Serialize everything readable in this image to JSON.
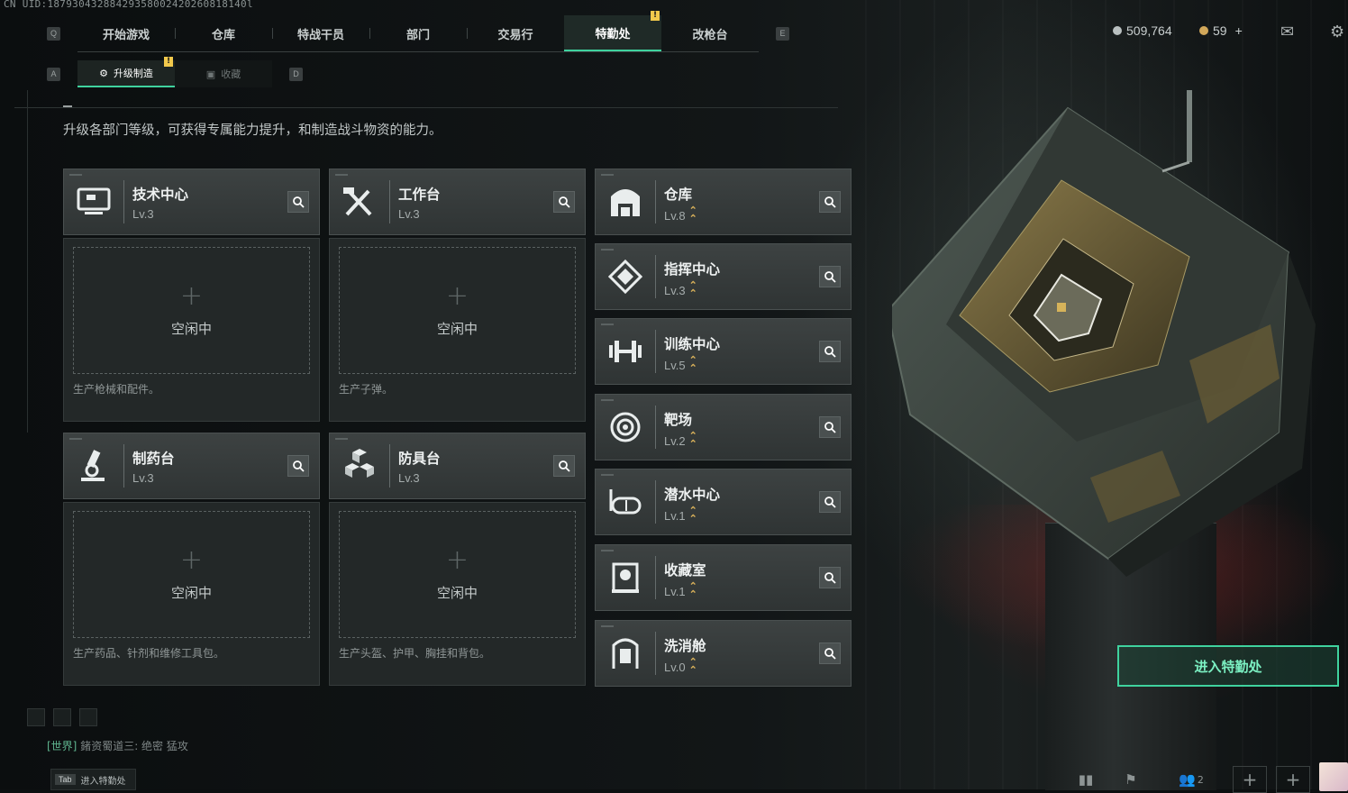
{
  "uid": "CN UID:18793043288429358002420260818140l",
  "nav": {
    "left_key": "Q",
    "right_key": "E",
    "tabs": [
      {
        "label": "开始游戏",
        "active": false
      },
      {
        "label": "仓库",
        "active": false
      },
      {
        "label": "特战干员",
        "active": false
      },
      {
        "label": "部门",
        "active": false
      },
      {
        "label": "交易行",
        "active": false
      },
      {
        "label": "特勤处",
        "active": true,
        "alert": "!"
      },
      {
        "label": "改枪台",
        "active": false
      }
    ]
  },
  "currency": {
    "coins": "509,764",
    "bonds": "59",
    "add": "+"
  },
  "subnav": {
    "left_key": "A",
    "right_key": "D",
    "tabs": [
      {
        "label": "升级制造",
        "active": true,
        "alert": "!"
      },
      {
        "label": "收藏",
        "active": false
      }
    ]
  },
  "description": "升级各部门等级，可获得专属能力提升，和制造战斗物资的能力。",
  "production_departments": [
    {
      "name": "技术中心",
      "level": "Lv.3",
      "icon": "monitor-icon",
      "status": "空闲中",
      "desc": "生产枪械和配件。"
    },
    {
      "name": "工作台",
      "level": "Lv.3",
      "icon": "tools-icon",
      "status": "空闲中",
      "desc": "生产子弹。"
    },
    {
      "name": "制药台",
      "level": "Lv.3",
      "icon": "microscope-icon",
      "status": "空闲中",
      "desc": "生产药品、针剂和维修工具包。"
    },
    {
      "name": "防具台",
      "level": "Lv.3",
      "icon": "armor-blocks-icon",
      "status": "空闲中",
      "desc": "生产头盔、护甲、胸挂和背包。"
    }
  ],
  "facilities": [
    {
      "name": "仓库",
      "level": "Lv.8",
      "icon": "warehouse-icon",
      "upgradable": true
    },
    {
      "name": "指挥中心",
      "level": "Lv.3",
      "icon": "command-icon",
      "upgradable": true
    },
    {
      "name": "训练中心",
      "level": "Lv.5",
      "icon": "dumbbell-icon",
      "upgradable": true
    },
    {
      "name": "靶场",
      "level": "Lv.2",
      "icon": "target-icon",
      "upgradable": true
    },
    {
      "name": "潜水中心",
      "level": "Lv.1",
      "icon": "diving-mask-icon",
      "upgradable": true
    },
    {
      "name": "收藏室",
      "level": "Lv.1",
      "icon": "display-case-icon",
      "upgradable": true
    },
    {
      "name": "洗消舱",
      "level": "Lv.0",
      "icon": "decon-pod-icon",
      "upgradable": true
    }
  ],
  "enter_button": "进入特勤处",
  "chat": {
    "channel": "[世界]",
    "text": "鍺资蜀道三: 绝密 猛攻"
  },
  "tab_hint": {
    "key": "Tab",
    "label": "进入特勤处"
  },
  "bottom_bar": {
    "friends_count": "2"
  },
  "colors": {
    "accent": "#3fd29e",
    "alert": "#f2c94c",
    "level_up": "#d9b15a"
  }
}
